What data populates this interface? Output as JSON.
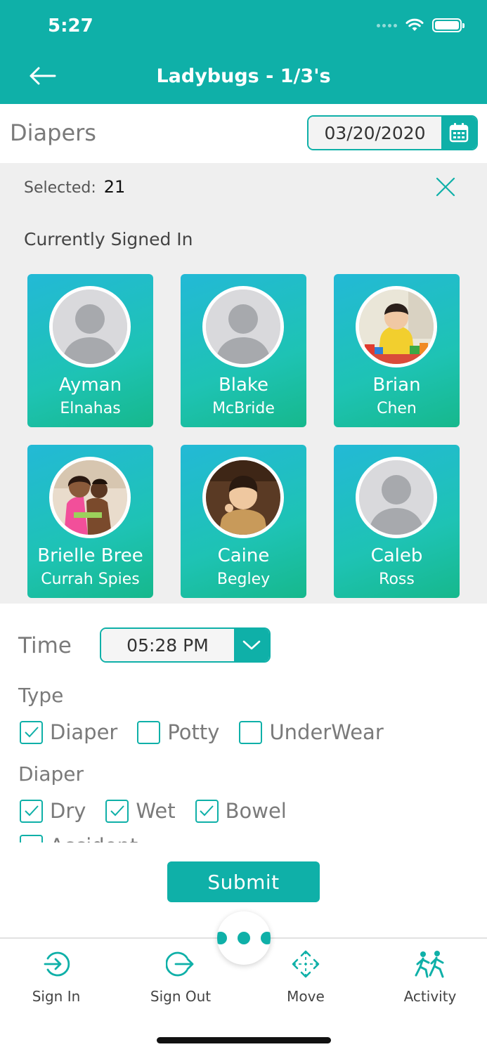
{
  "status_bar": {
    "time": "5:27"
  },
  "header": {
    "title": "Ladybugs - 1/3's"
  },
  "page": {
    "title": "Diapers",
    "date": "03/20/2020"
  },
  "selection": {
    "label": "Selected:",
    "count": "21",
    "section_heading": "Currently Signed In"
  },
  "children": [
    {
      "first": "Ayman",
      "last": "Elnahas",
      "avatar": "placeholder"
    },
    {
      "first": "Blake",
      "last": "McBride",
      "avatar": "placeholder"
    },
    {
      "first": "Brian",
      "last": "Chen",
      "avatar": "photo"
    },
    {
      "first": "Brielle Bree",
      "last": "Currah Spies",
      "avatar": "photo"
    },
    {
      "first": "Caine",
      "last": "Begley",
      "avatar": "photo"
    },
    {
      "first": "Caleb",
      "last": "Ross",
      "avatar": "placeholder"
    }
  ],
  "form": {
    "time_label": "Time",
    "time_value": "05:28 PM",
    "type_label": "Type",
    "type_options": [
      {
        "label": "Diaper",
        "checked": true
      },
      {
        "label": "Potty",
        "checked": false
      },
      {
        "label": "UnderWear",
        "checked": false
      }
    ],
    "diaper_label": "Diaper",
    "diaper_options": [
      {
        "label": "Dry",
        "checked": true
      },
      {
        "label": "Wet",
        "checked": true
      },
      {
        "label": "Bowel",
        "checked": true
      }
    ],
    "diaper_option_extra": {
      "label": "Accident",
      "checked": false
    },
    "submit_label": "Submit"
  },
  "tabs": [
    {
      "label": "Sign In",
      "icon": "sign-in-icon"
    },
    {
      "label": "Sign Out",
      "icon": "sign-out-icon"
    },
    {
      "label": "Move",
      "icon": "move-icon"
    },
    {
      "label": "Activity",
      "icon": "activity-icon"
    }
  ],
  "colors": {
    "accent": "#0fb0a8",
    "background_gray": "#efefef"
  }
}
